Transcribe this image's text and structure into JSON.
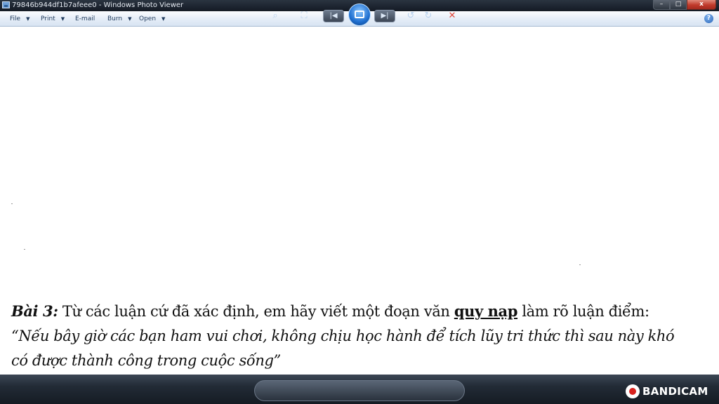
{
  "window": {
    "title": "79846b944df1b7afeee0 - Windows Photo Viewer",
    "buttons": {
      "minimize": "–",
      "maximize": "□",
      "close": "x"
    }
  },
  "menu": {
    "file": "File",
    "print": "Print",
    "email": "E-mail",
    "burn": "Burn",
    "open": "Open",
    "help": "?"
  },
  "document": {
    "line1": {
      "label": "Bài 3:",
      "text_before": " Từ các luận cứ đã xác định, em hãy viết một đoạn văn ",
      "keyword": "quy nạp",
      "text_after": " làm rõ luận điểm:"
    },
    "quote_line1": "“Nếu bây giờ các bạn ham vui chơi, không chịu học hành để tích lũy tri thức thì sau này khó",
    "quote_line2": "có được thành công trong cuộc sống”"
  },
  "controls": {
    "zoom": "⌕",
    "fit": "⛶",
    "previous": "|◀",
    "next": "▶|",
    "rotate_ccw": "↺",
    "rotate_cw": "↻",
    "delete": "✕"
  },
  "watermark": {
    "text": "BANDICAM"
  }
}
